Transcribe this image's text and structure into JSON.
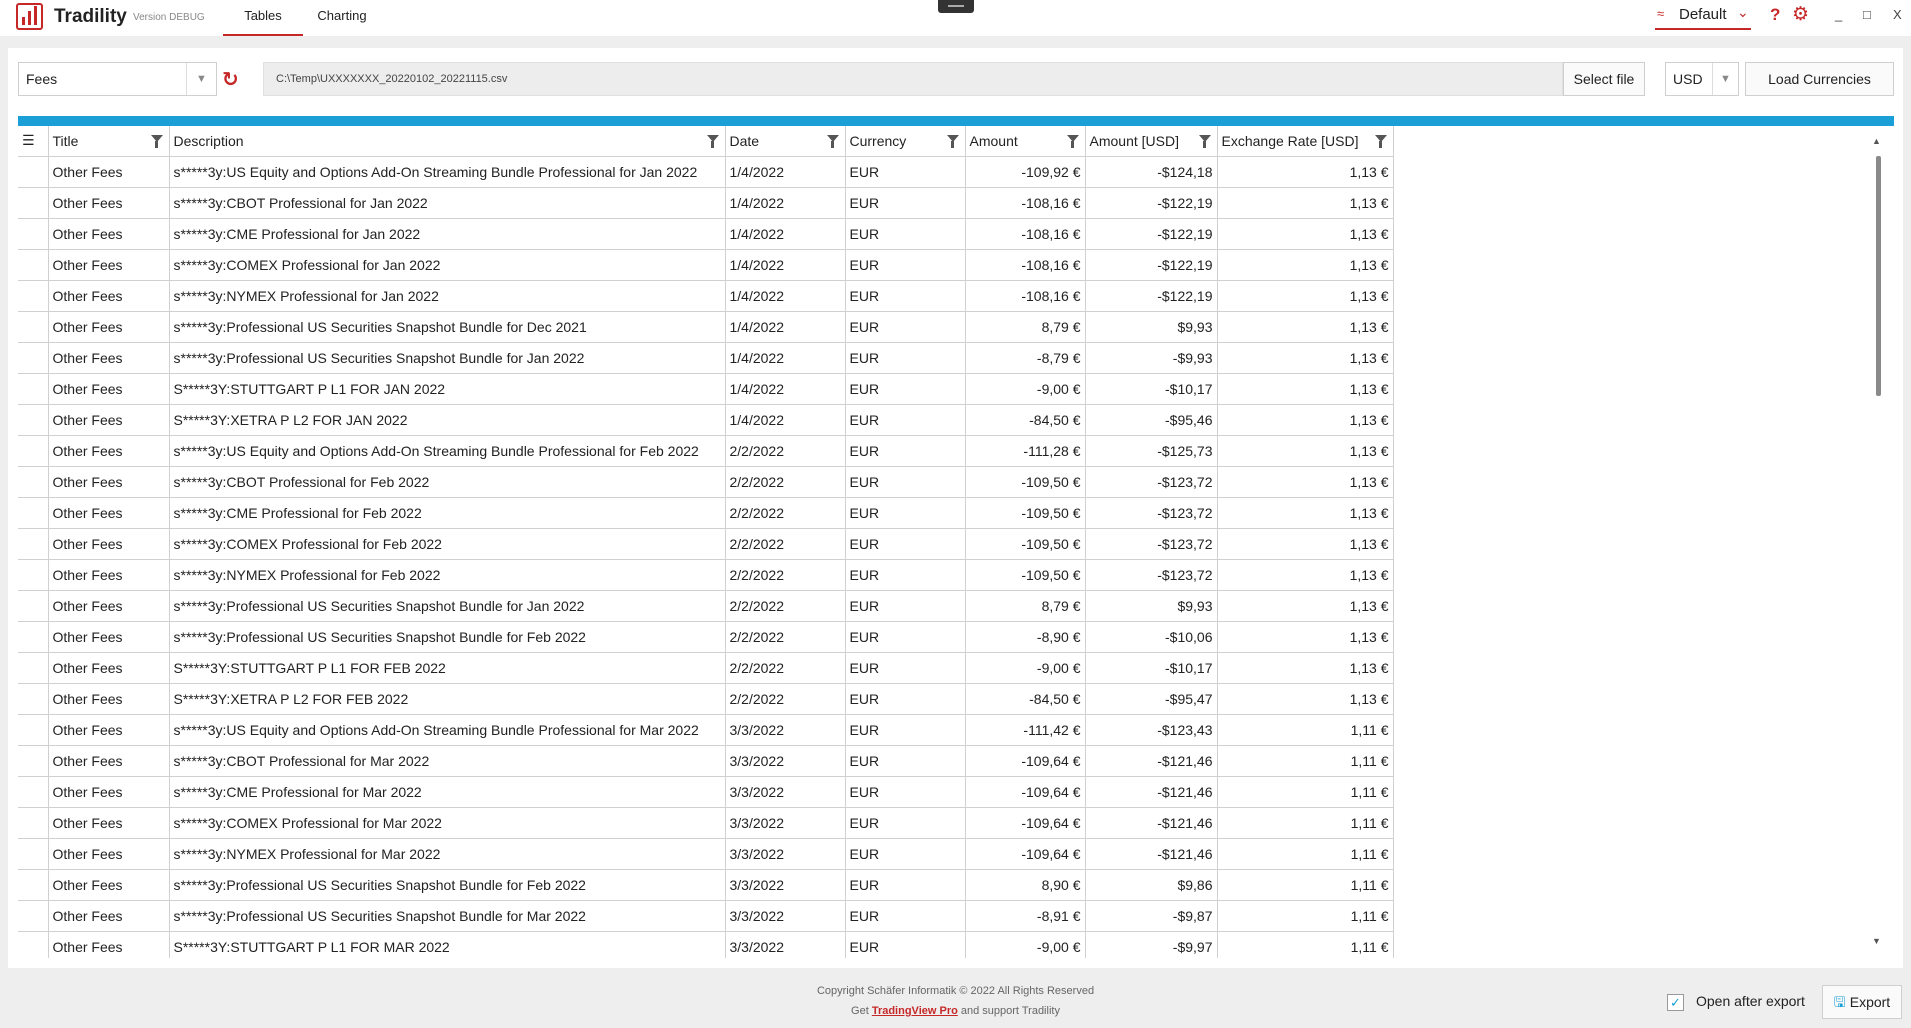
{
  "app": {
    "title": "Tradility",
    "version": "Version DEBUG",
    "tabs": [
      {
        "label": "Tables",
        "active": true
      },
      {
        "label": "Charting",
        "active": false
      }
    ],
    "profile": "Default",
    "window_controls": {
      "minimize": "_",
      "maximize": "□",
      "close": "X"
    },
    "accent_color": "#c62828",
    "grid_accent_color": "#1a9fd6"
  },
  "toolbar": {
    "category": "Fees",
    "file_path": "C:\\Temp\\UXXXXXXX_20220102_20221115.csv",
    "select_file_label": "Select file",
    "currency": "USD",
    "load_currencies_label": "Load Currencies"
  },
  "grid": {
    "columns": [
      "Title",
      "Description",
      "Date",
      "Currency",
      "Amount",
      "Amount [USD]",
      "Exchange Rate [USD]"
    ],
    "rows": [
      [
        "Other Fees",
        "s*****3y:US Equity and Options Add-On Streaming Bundle Professional for Jan 2022",
        "1/4/2022",
        "EUR",
        "-109,92 €",
        "-$124,18",
        "1,13 €"
      ],
      [
        "Other Fees",
        "s*****3y:CBOT Professional for Jan 2022",
        "1/4/2022",
        "EUR",
        "-108,16 €",
        "-$122,19",
        "1,13 €"
      ],
      [
        "Other Fees",
        "s*****3y:CME Professional for Jan 2022",
        "1/4/2022",
        "EUR",
        "-108,16 €",
        "-$122,19",
        "1,13 €"
      ],
      [
        "Other Fees",
        "s*****3y:COMEX Professional for Jan 2022",
        "1/4/2022",
        "EUR",
        "-108,16 €",
        "-$122,19",
        "1,13 €"
      ],
      [
        "Other Fees",
        "s*****3y:NYMEX Professional for Jan 2022",
        "1/4/2022",
        "EUR",
        "-108,16 €",
        "-$122,19",
        "1,13 €"
      ],
      [
        "Other Fees",
        "s*****3y:Professional US Securities Snapshot Bundle for Dec 2021",
        "1/4/2022",
        "EUR",
        "8,79 €",
        "$9,93",
        "1,13 €"
      ],
      [
        "Other Fees",
        "s*****3y:Professional US Securities Snapshot Bundle for Jan 2022",
        "1/4/2022",
        "EUR",
        "-8,79 €",
        "-$9,93",
        "1,13 €"
      ],
      [
        "Other Fees",
        "S*****3Y:STUTTGART P L1 FOR JAN 2022",
        "1/4/2022",
        "EUR",
        "-9,00 €",
        "-$10,17",
        "1,13 €"
      ],
      [
        "Other Fees",
        "S*****3Y:XETRA P L2 FOR JAN 2022",
        "1/4/2022",
        "EUR",
        "-84,50 €",
        "-$95,46",
        "1,13 €"
      ],
      [
        "Other Fees",
        "s*****3y:US Equity and Options Add-On Streaming Bundle Professional for Feb 2022",
        "2/2/2022",
        "EUR",
        "-111,28 €",
        "-$125,73",
        "1,13 €"
      ],
      [
        "Other Fees",
        "s*****3y:CBOT Professional for Feb 2022",
        "2/2/2022",
        "EUR",
        "-109,50 €",
        "-$123,72",
        "1,13 €"
      ],
      [
        "Other Fees",
        "s*****3y:CME Professional for Feb 2022",
        "2/2/2022",
        "EUR",
        "-109,50 €",
        "-$123,72",
        "1,13 €"
      ],
      [
        "Other Fees",
        "s*****3y:COMEX Professional for Feb 2022",
        "2/2/2022",
        "EUR",
        "-109,50 €",
        "-$123,72",
        "1,13 €"
      ],
      [
        "Other Fees",
        "s*****3y:NYMEX Professional for Feb 2022",
        "2/2/2022",
        "EUR",
        "-109,50 €",
        "-$123,72",
        "1,13 €"
      ],
      [
        "Other Fees",
        "s*****3y:Professional US Securities Snapshot Bundle for Jan 2022",
        "2/2/2022",
        "EUR",
        "8,79 €",
        "$9,93",
        "1,13 €"
      ],
      [
        "Other Fees",
        "s*****3y:Professional US Securities Snapshot Bundle for Feb 2022",
        "2/2/2022",
        "EUR",
        "-8,90 €",
        "-$10,06",
        "1,13 €"
      ],
      [
        "Other Fees",
        "S*****3Y:STUTTGART P L1 FOR FEB 2022",
        "2/2/2022",
        "EUR",
        "-9,00 €",
        "-$10,17",
        "1,13 €"
      ],
      [
        "Other Fees",
        "S*****3Y:XETRA P L2 FOR FEB 2022",
        "2/2/2022",
        "EUR",
        "-84,50 €",
        "-$95,47",
        "1,13 €"
      ],
      [
        "Other Fees",
        "s*****3y:US Equity and Options Add-On Streaming Bundle Professional for Mar 2022",
        "3/3/2022",
        "EUR",
        "-111,42 €",
        "-$123,43",
        "1,11 €"
      ],
      [
        "Other Fees",
        "s*****3y:CBOT Professional for Mar 2022",
        "3/3/2022",
        "EUR",
        "-109,64 €",
        "-$121,46",
        "1,11 €"
      ],
      [
        "Other Fees",
        "s*****3y:CME Professional for Mar 2022",
        "3/3/2022",
        "EUR",
        "-109,64 €",
        "-$121,46",
        "1,11 €"
      ],
      [
        "Other Fees",
        "s*****3y:COMEX Professional for Mar 2022",
        "3/3/2022",
        "EUR",
        "-109,64 €",
        "-$121,46",
        "1,11 €"
      ],
      [
        "Other Fees",
        "s*****3y:NYMEX Professional for Mar 2022",
        "3/3/2022",
        "EUR",
        "-109,64 €",
        "-$121,46",
        "1,11 €"
      ],
      [
        "Other Fees",
        "s*****3y:Professional US Securities Snapshot Bundle for Feb 2022",
        "3/3/2022",
        "EUR",
        "8,90 €",
        "$9,86",
        "1,11 €"
      ],
      [
        "Other Fees",
        "s*****3y:Professional US Securities Snapshot Bundle for Mar 2022",
        "3/3/2022",
        "EUR",
        "-8,91 €",
        "-$9,87",
        "1,11 €"
      ],
      [
        "Other Fees",
        "S*****3Y:STUTTGART P L1 FOR MAR 2022",
        "3/3/2022",
        "EUR",
        "-9,00 €",
        "-$9,97",
        "1,11 €"
      ]
    ]
  },
  "footer": {
    "copyright": "Copyright Schäfer Informatik © 2022 All Rights Reserved",
    "promo_prefix": "Get",
    "promo_link": "TradingView Pro",
    "promo_suffix": "and support Tradility",
    "open_after_export_label": "Open after export",
    "open_after_export_checked": true,
    "export_label": "Export"
  }
}
